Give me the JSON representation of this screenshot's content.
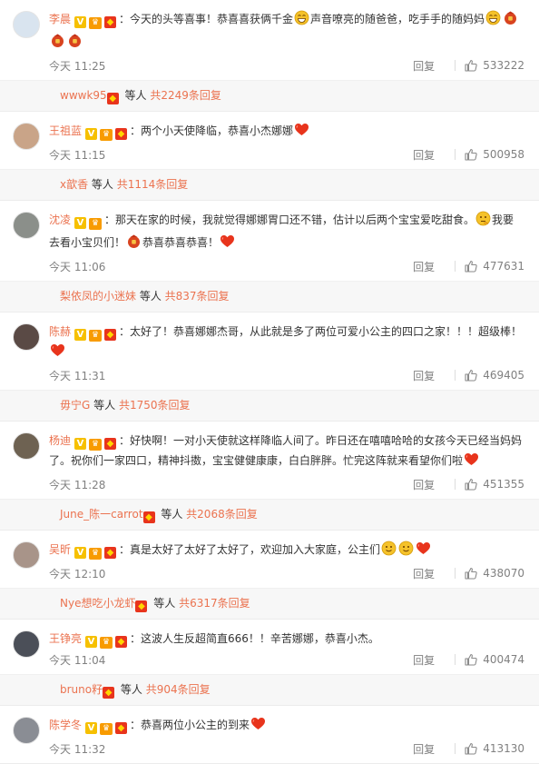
{
  "colors": {
    "name": "#eb7350",
    "link": "#eb7350",
    "meta": "#808080",
    "heart": "#e8341c"
  },
  "comments": [
    {
      "name": "李晨",
      "badges": [
        "v",
        "vip",
        "red"
      ],
      "avatar_color": "#d9e4ef",
      "segments": [
        {
          "t": "：今天的头等喜事！恭喜喜获俩千金"
        },
        {
          "e": "grin"
        },
        {
          "t": "声音嘹亮的随爸爸，吃手手的随妈妈"
        },
        {
          "e": "grin"
        },
        {
          "e": "redbag"
        },
        {
          "e": "redbag"
        },
        {
          "e": "redbag"
        }
      ],
      "time": "今天 11:25",
      "reply": "回复",
      "likes": "533222",
      "sub": {
        "user": "wwwk95",
        "badge": true,
        "mid": " 等人 ",
        "link": "共2249条回复"
      }
    },
    {
      "name": "王祖蓝",
      "badges": [
        "v",
        "vip",
        "red"
      ],
      "avatar_color": "#c9a488",
      "segments": [
        {
          "t": "：两个小天使降临，恭喜小杰娜娜"
        },
        {
          "e": "heart"
        }
      ],
      "time": "今天 11:15",
      "reply": "回复",
      "likes": "500958",
      "sub": {
        "user": "x歆香",
        "badge": false,
        "mid": " 等人 ",
        "link": "共1114条回复"
      }
    },
    {
      "name": "沈凌",
      "badges": [
        "v",
        "vip"
      ],
      "avatar_color": "#8b8f8a",
      "segments": [
        {
          "t": "：那天在家的时候，我就觉得娜娜胃口还不错，估计以后两个宝宝爱吃甜食。"
        },
        {
          "e": "think"
        },
        {
          "t": "我要去看小宝贝们！"
        },
        {
          "e": "redbag"
        },
        {
          "t": "恭喜恭喜恭喜！"
        },
        {
          "e": "heart"
        }
      ],
      "time": "今天 11:06",
      "reply": "回复",
      "likes": "477631",
      "sub": {
        "user": "梨依凤的小迷妹",
        "badge": false,
        "mid": " 等人 ",
        "link": "共837条回复"
      }
    },
    {
      "name": "陈赫",
      "badges": [
        "v",
        "vip",
        "red"
      ],
      "avatar_color": "#5a4a45",
      "segments": [
        {
          "t": "：太好了！恭喜娜娜杰哥，从此就是多了两位可爱小公主的四口之家！！！超级棒！"
        },
        {
          "e": "heart"
        }
      ],
      "time": "今天 11:31",
      "reply": "回复",
      "likes": "469405",
      "sub": {
        "user": "毋宁G",
        "badge": false,
        "mid": " 等人 ",
        "link": "共1750条回复"
      }
    },
    {
      "name": "杨迪",
      "badges": [
        "v",
        "vip",
        "red"
      ],
      "avatar_color": "#6e6252",
      "segments": [
        {
          "t": "：好快啊！一对小天使就这样降临人间了。昨日还在嘻嘻哈哈的女孩今天已经当妈妈了。祝你们一家四口，精神抖擞，宝宝健健康康，白白胖胖。忙完这阵就来看望你们啦"
        },
        {
          "e": "heart"
        }
      ],
      "time": "今天 11:28",
      "reply": "回复",
      "likes": "451355",
      "sub": {
        "user": "June_陈一carrot",
        "badge": true,
        "mid": " 等人 ",
        "link": "共2068条回复"
      }
    },
    {
      "name": "吴昕",
      "badges": [
        "v",
        "vip",
        "red"
      ],
      "avatar_color": "#a89489",
      "segments": [
        {
          "t": "：真是太好了太好了太好了，欢迎加入大家庭，公主们"
        },
        {
          "e": "smile"
        },
        {
          "e": "smile"
        },
        {
          "e": "heart"
        }
      ],
      "time": "今天 12:10",
      "reply": "回复",
      "likes": "438070",
      "sub": {
        "user": "Nye想吃小龙虾",
        "badge": true,
        "mid": " 等人 ",
        "link": "共6317条回复"
      }
    },
    {
      "name": "王铮亮",
      "badges": [
        "v",
        "vip",
        "red"
      ],
      "avatar_color": "#4b4f58",
      "segments": [
        {
          "t": "：这波人生反超简直666！！辛苦娜娜，恭喜小杰。"
        }
      ],
      "time": "今天 11:04",
      "reply": "回复",
      "likes": "400474",
      "sub": {
        "user": "bruno籽",
        "badge": true,
        "mid": " 等人 ",
        "link": "共904条回复"
      }
    },
    {
      "name": "陈学冬",
      "badges": [
        "v",
        "vip",
        "red"
      ],
      "avatar_color": "#8a8d94",
      "segments": [
        {
          "t": "：恭喜两位小公主的到来"
        },
        {
          "e": "heart"
        }
      ],
      "time": "今天 11:32",
      "reply": "回复",
      "likes": "413130",
      "sub": null
    }
  ]
}
